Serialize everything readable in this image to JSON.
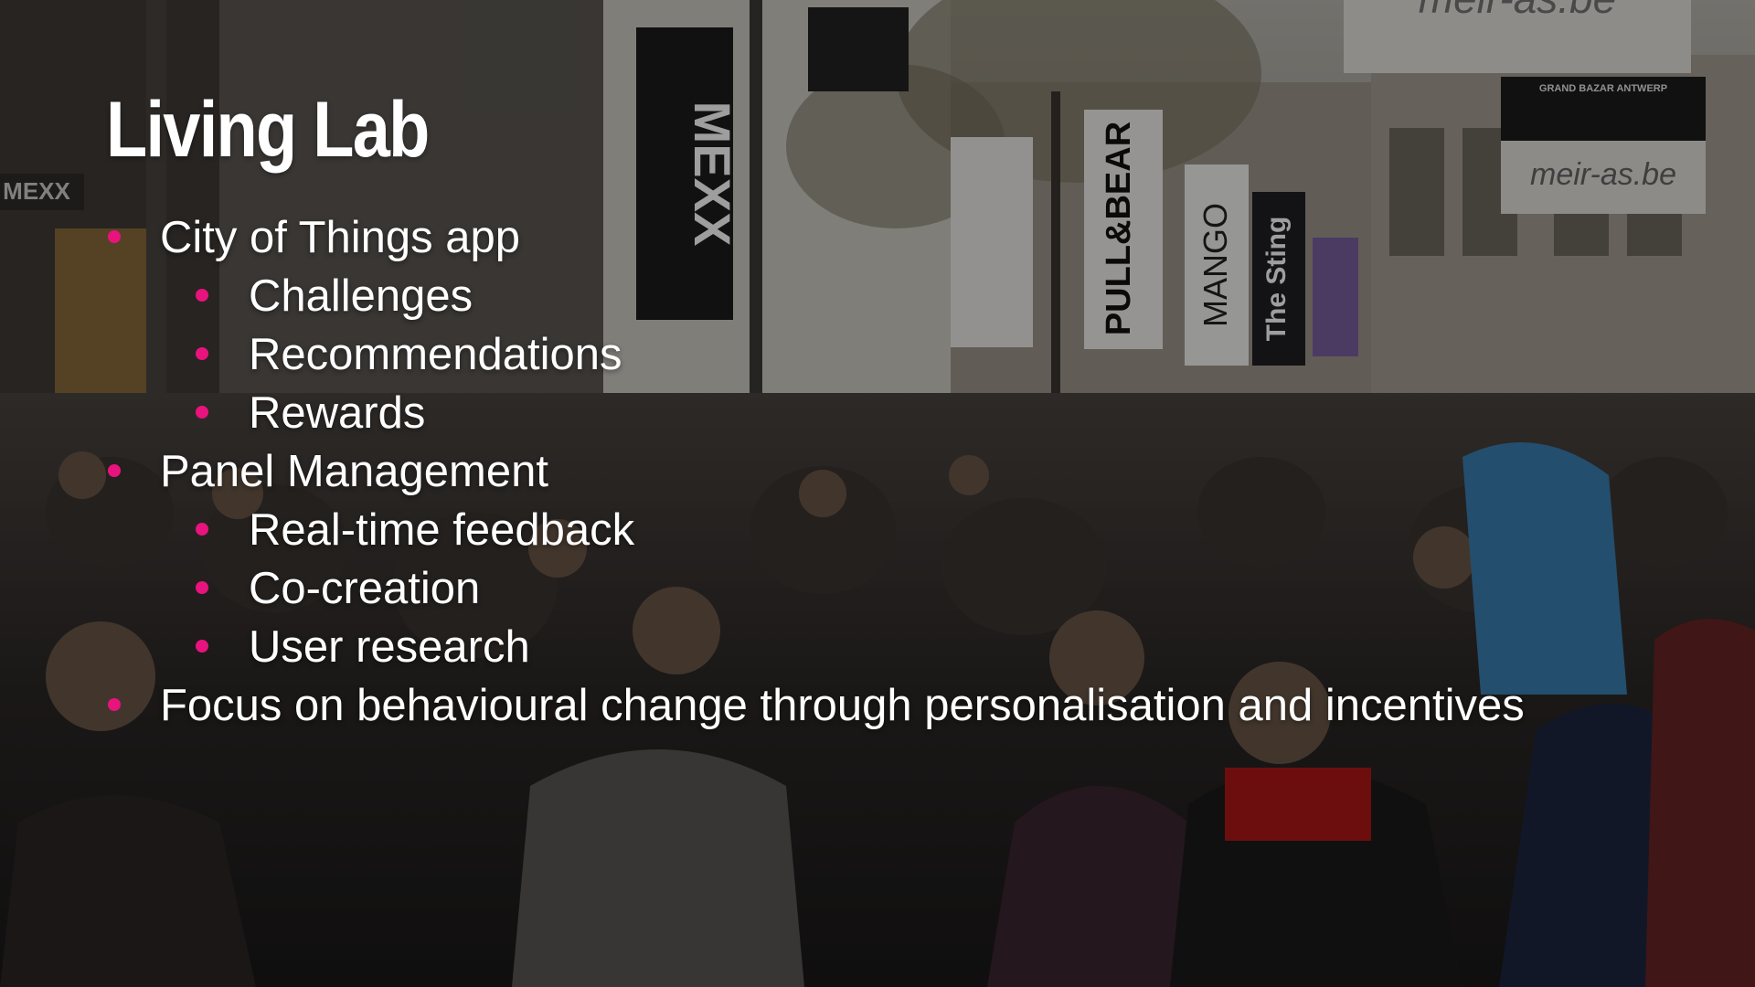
{
  "slide": {
    "title": "Living Lab",
    "accent_color": "#e8137d",
    "bullets": [
      {
        "level": 1,
        "text": "City of Things app"
      },
      {
        "level": 2,
        "text": "Challenges"
      },
      {
        "level": 2,
        "text": "Recommendations"
      },
      {
        "level": 2,
        "text": "Rewards"
      },
      {
        "level": 1,
        "text": "Panel Management"
      },
      {
        "level": 2,
        "text": "Real-time feedback"
      },
      {
        "level": 2,
        "text": "Co-creation"
      },
      {
        "level": 2,
        "text": "User research"
      },
      {
        "level": 1,
        "text": "Focus on behavioural change through personalisation and incentives"
      }
    ]
  },
  "background": {
    "description_icon": "crowded-shopping-street-photo",
    "signs": {
      "mexx_banner": "MEXX",
      "pull_bear_banner": "PULL&BEAR",
      "mango_banner": "MANGO",
      "sting_banner": "The Sting",
      "meir_sign_top": "meir-as.be",
      "meir_sign_right": "meir-as.be",
      "grand_bazar": "GRAND BAZAR ANTWERP",
      "mexx_storefront": "MEXX"
    }
  }
}
